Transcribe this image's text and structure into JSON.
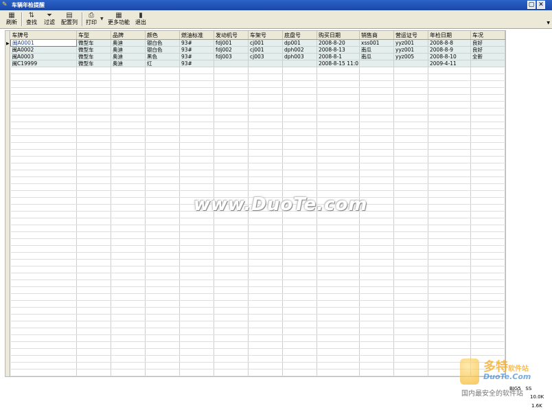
{
  "window": {
    "title": "车辆年检提醒"
  },
  "toolbar": {
    "refresh": "刷新",
    "search": "查找",
    "filter": "过滤",
    "config_columns": "配置列",
    "print": "打印",
    "more": "更多功能",
    "exit": "退出"
  },
  "grid": {
    "columns": [
      "车牌号",
      "车型",
      "品牌",
      "颜色",
      "燃油标准",
      "发动机号",
      "车架号",
      "底盘号",
      "购买日期",
      "销售商",
      "营运证号",
      "年检日期",
      "车况"
    ],
    "rows": [
      [
        "闽A0001",
        "微型车",
        "奥迪",
        "银白色",
        "93#",
        "fdj001",
        "cj001",
        "dp001",
        "2008-8-20",
        "xss001",
        "yyz001",
        "2008-8-8",
        "良好"
      ],
      [
        "闽A0002",
        "微型车",
        "奥迪",
        "银白色",
        "93#",
        "fdj002",
        "cj001",
        "dph002",
        "2008-8-13",
        "南瓜",
        "yyz001",
        "2008-8-9",
        "良好"
      ],
      [
        "闽A0003",
        "微型车",
        "奥迪",
        "黑色",
        "93#",
        "fdj003",
        "cj003",
        "dph003",
        "2008-8-1",
        "南瓜",
        "yyz005",
        "2008-8-10",
        "全新"
      ],
      [
        "闽C19999",
        "微型车",
        "奥迪",
        "红",
        "93#",
        "",
        "",
        "",
        "2008-8-15 11:0",
        "",
        "",
        "2009-4-11",
        ""
      ]
    ]
  },
  "watermark": {
    "site": "www.DuoTe.com",
    "brand_cn": "多特",
    "brand_suffix": "软件站",
    "brand_en": "DuoTe.Com",
    "slogan": "国内最安全的软件站"
  },
  "tray": {
    "l1": "BIG5   SS",
    "l2": "10.0K",
    "l3": "1.6K"
  }
}
